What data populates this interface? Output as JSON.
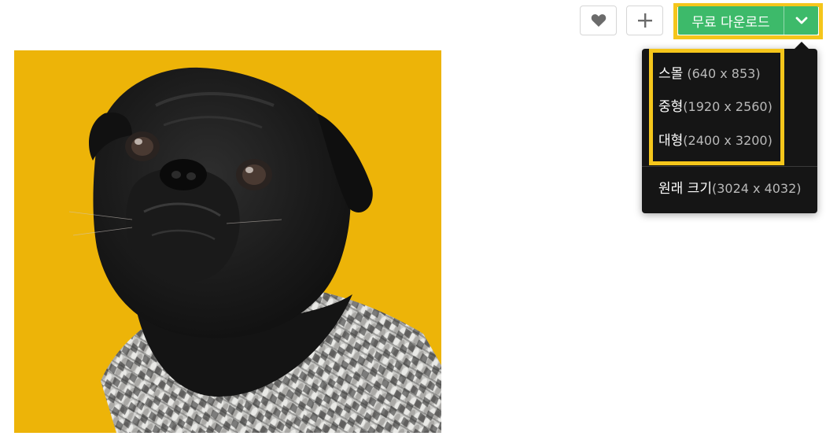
{
  "toolbar": {
    "like_icon": "heart-icon",
    "add_icon": "plus-icon",
    "download_label": "무료 다운로드",
    "dropdown_icon": "chevron-down-icon",
    "accent_color": "#3dba6a",
    "highlight_color": "#f5c61b"
  },
  "download_menu": {
    "items": [
      {
        "name": "스몰",
        "dims": " (640 x 853)"
      },
      {
        "name": "중형",
        "dims": "(1920 x 2560)"
      },
      {
        "name": "대형",
        "dims": "(2400 x 3200)"
      },
      {
        "name": "원래 크기",
        "dims": "(3024 x 4032)"
      }
    ]
  },
  "photo": {
    "subject": "black pug wearing a knitted scarf on yellow background",
    "background_color": "#edb408"
  }
}
